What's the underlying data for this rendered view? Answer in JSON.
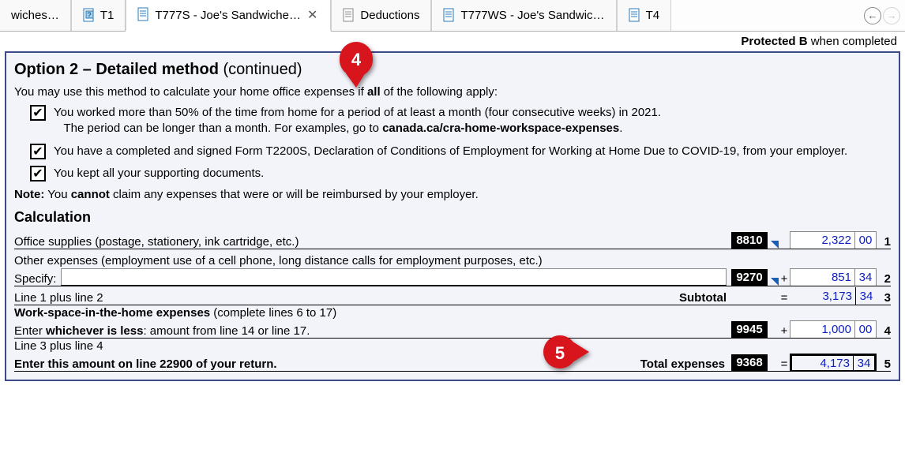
{
  "tabs": [
    {
      "label": "wiches…",
      "icon": "none"
    },
    {
      "label": "T1",
      "icon": "help"
    },
    {
      "label": "T777S - Joe's Sandwiche…",
      "icon": "doc",
      "active": true,
      "closeable": true
    },
    {
      "label": "Deductions",
      "icon": "doc"
    },
    {
      "label": "T777WS - Joe's Sandwic…",
      "icon": "doc"
    },
    {
      "label": "T4",
      "icon": "doc"
    }
  ],
  "protected_line": {
    "prefix": "Protected B",
    "suffix": " when completed"
  },
  "heading": {
    "main": "Option 2 – Detailed method",
    "cont": "(continued)"
  },
  "intro": {
    "p1": "You may use this method to calculate your home office expenses if ",
    "bold": "all",
    "p2": " of the following apply:"
  },
  "checks": [
    {
      "l1": "You worked more than 50% of the time from home for a period of at least a month (four consecutive weeks) in 2021.",
      "l2a": "The period can be longer than a month. For examples, go to ",
      "l2b": "canada.ca/cra-home-workspace-expenses",
      "l2c": "."
    },
    {
      "text": "You have a completed and signed Form T2200S, Declaration of Conditions of Employment for Working at Home Due to COVID-19, from your employer."
    },
    {
      "text": "You kept all your supporting documents."
    }
  ],
  "note": {
    "b1": "Note:",
    "t1": " You ",
    "b2": "cannot",
    "t2": " claim any expenses that were or will be reimbursed by your employer."
  },
  "calc_heading": "Calculation",
  "lines": {
    "l1": {
      "label": "Office supplies (postage, stationery, ink cartridge, etc.)",
      "code": "8810",
      "dollars": "2,322",
      "cents": "00",
      "num": "1"
    },
    "other": "Other expenses (employment use of a cell phone, long distance calls for employment purposes, etc.)",
    "specify": "Specify:",
    "l2": {
      "code": "9270",
      "op": "+",
      "dollars": "851",
      "cents": "34",
      "num": "2"
    },
    "l3": {
      "label": "Line 1 plus line 2",
      "sub": "Subtotal",
      "op": "=",
      "dollars": "3,173",
      "cents": "34",
      "num": "3"
    },
    "wsh1": "Work-space-in-the-home expenses",
    "wsh1b": " (complete lines 6 to 17)",
    "wsh2a": "Enter ",
    "wsh2b": "whichever is less",
    "wsh2c": ": amount from line 14 or line 17.",
    "l4": {
      "code": "9945",
      "op": "+",
      "dollars": "1,000",
      "cents": "00",
      "num": "4"
    },
    "l5a": "Line 3 plus line 4",
    "l5b": "Enter this amount on line 22900 of your return.",
    "l5": {
      "total": "Total expenses",
      "code": "9368",
      "op": "=",
      "dollars": "4,173",
      "cents": "34",
      "num": "5"
    }
  },
  "callouts": {
    "a": "4",
    "b": "5"
  }
}
